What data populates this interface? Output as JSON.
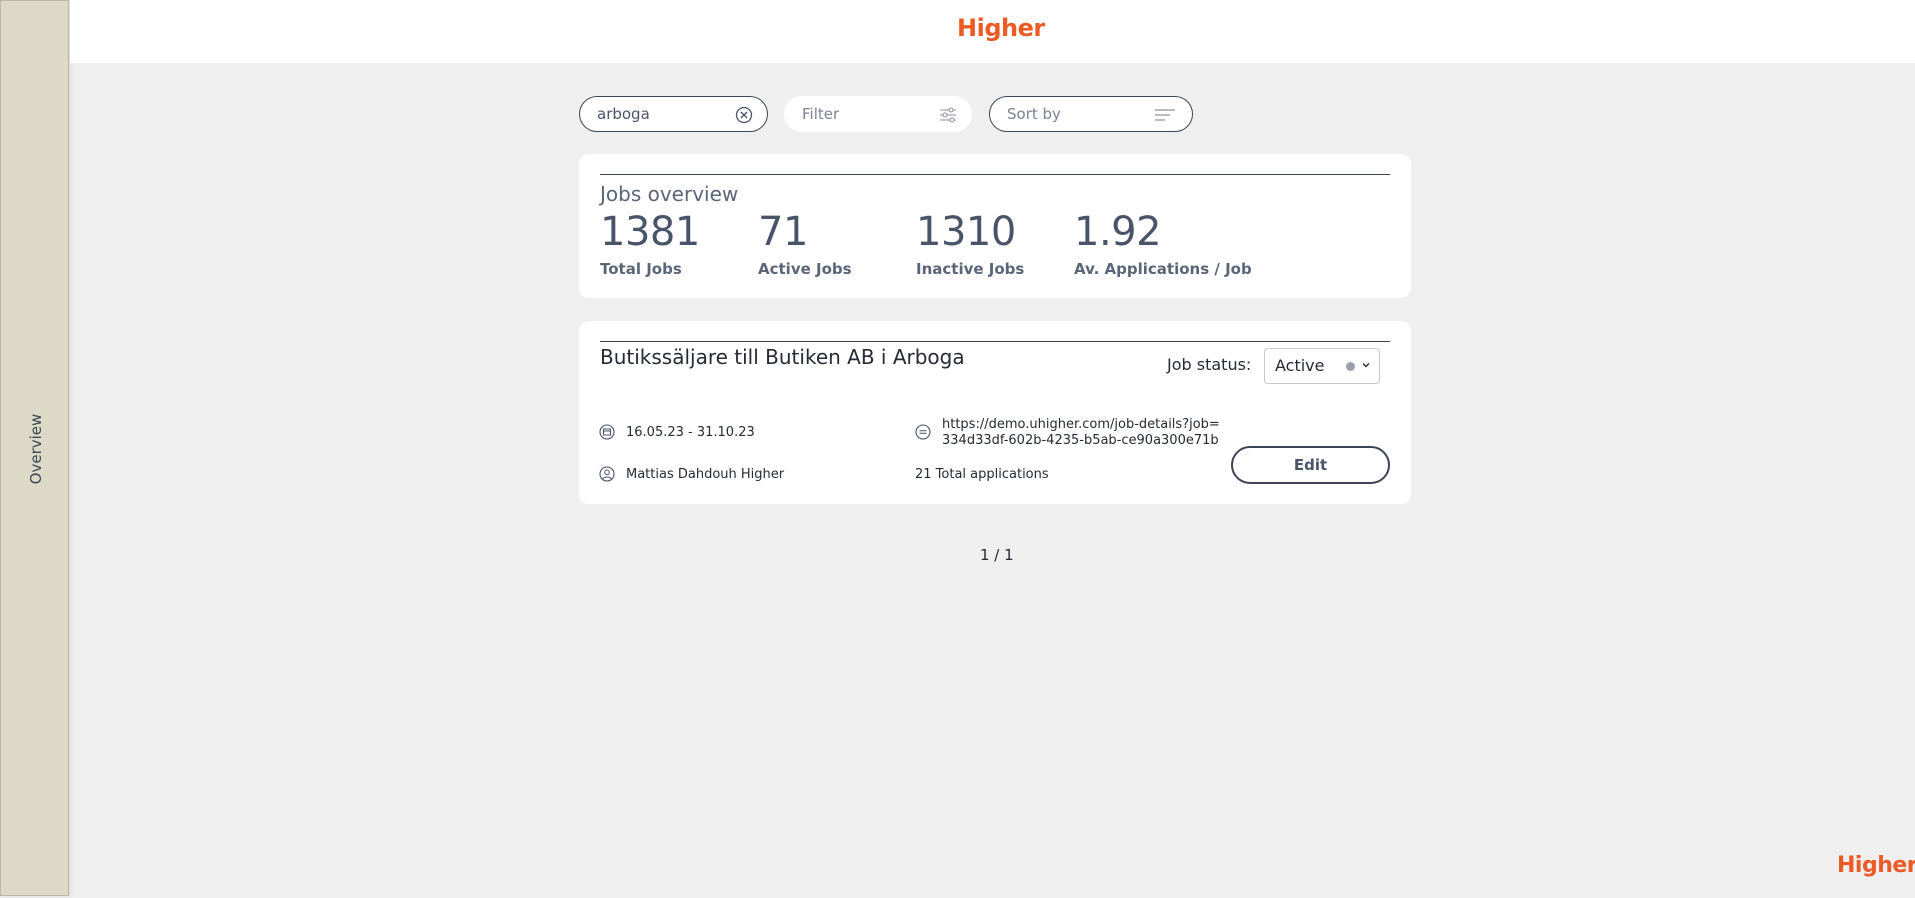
{
  "brand": {
    "logo": "Higher",
    "color": "#ec5a26"
  },
  "sidebar": {
    "label": "Overview"
  },
  "toolbar": {
    "search_value": "arboga",
    "filter_label": "Filter",
    "sort_label": "Sort by"
  },
  "overview": {
    "title": "Jobs overview",
    "stats": [
      {
        "value": "1381",
        "label": "Total Jobs"
      },
      {
        "value": "71",
        "label": "Active Jobs"
      },
      {
        "value": "1310",
        "label": "Inactive Jobs"
      },
      {
        "value": "1.92",
        "label": "Av. Applications / Job"
      }
    ]
  },
  "job": {
    "title": "Butikssäljare till Butiken AB i Arboga",
    "status_label": "Job status:",
    "status_value": "Active",
    "dates": "16.05.23 - 31.10.23",
    "link_line1": "https://demo.uhigher.com/job-details?job=",
    "link_line2": "334d33df-602b-4235-b5ab-ce90a300e71b",
    "owner": "Mattias Dahdouh Higher",
    "applications": "21 Total applications",
    "edit_label": "Edit"
  },
  "pagination": "1 / 1"
}
